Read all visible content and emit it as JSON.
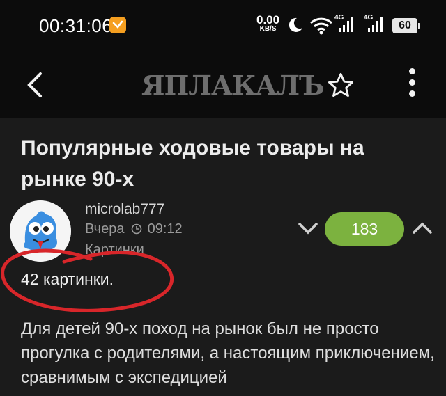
{
  "status_bar": {
    "time": "00:31:06",
    "net_speed_value": "0.00",
    "net_speed_unit": "KB/S",
    "signal1_label": "4G",
    "signal2_label": "4G",
    "battery": "60",
    "icons": [
      "notification-app-icon",
      "moon-icon",
      "wifi-icon",
      "signal-icon",
      "signal-icon",
      "battery-icon"
    ]
  },
  "app_bar": {
    "logo": "ЯПЛАКАЛЪ",
    "icons": [
      "back-arrow-icon",
      "star-icon",
      "more-vertical-icon"
    ]
  },
  "post": {
    "title": "Популярные ходовые товары на рынке 90-х",
    "author": "microlab777",
    "date_day": "Вчера",
    "date_time": "09:12",
    "category": "Картинки",
    "rating": "183",
    "pictures_count": "42 картинки.",
    "body": "Для детей 90-х поход на рынок был не просто прогулка с родителями, а настоящим приключением, сравнимым с экспедицией"
  },
  "colors": {
    "background": "#1b1b1b",
    "rating_badge": "#7cb23f",
    "annotation": "#d8262a"
  }
}
